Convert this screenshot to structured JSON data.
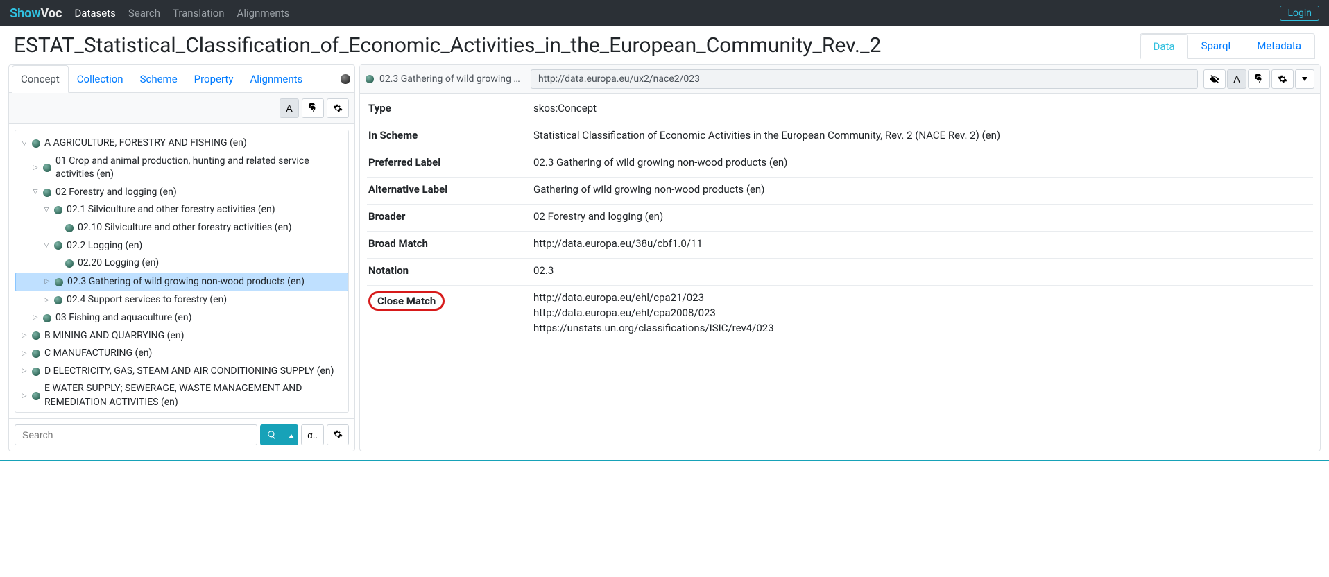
{
  "nav": {
    "brand1": "Show",
    "brand2": "Voc",
    "items": [
      "Datasets",
      "Search",
      "Translation",
      "Alignments"
    ],
    "login": "Login"
  },
  "header": {
    "title": "ESTAT_Statistical_Classification_of_Economic_Activities_in_the_European_Community_Rev._2",
    "tabs": [
      "Data",
      "Sparql",
      "Metadata"
    ]
  },
  "leftTabs": [
    "Concept",
    "Collection",
    "Scheme",
    "Property",
    "Alignments"
  ],
  "toolbar": {
    "alpha": "A"
  },
  "tree": [
    {
      "indent": 0,
      "caret": "open",
      "label": "A AGRICULTURE, FORESTRY AND FISHING (en)"
    },
    {
      "indent": 1,
      "caret": "closed",
      "label": "01 Crop and animal production, hunting and related service activities (en)"
    },
    {
      "indent": 1,
      "caret": "open",
      "label": "02 Forestry and logging (en)"
    },
    {
      "indent": 2,
      "caret": "open",
      "label": "02.1 Silviculture and other forestry activities (en)"
    },
    {
      "indent": 3,
      "caret": "none",
      "label": "02.10 Silviculture and other forestry activities (en)"
    },
    {
      "indent": 2,
      "caret": "open",
      "label": "02.2 Logging (en)"
    },
    {
      "indent": 3,
      "caret": "none",
      "label": "02.20 Logging (en)"
    },
    {
      "indent": 2,
      "caret": "closed",
      "label": "02.3 Gathering of wild growing non-wood products (en)",
      "selected": true
    },
    {
      "indent": 2,
      "caret": "closed",
      "label": "02.4 Support services to forestry (en)"
    },
    {
      "indent": 1,
      "caret": "closed",
      "label": "03 Fishing and aquaculture (en)"
    },
    {
      "indent": 0,
      "caret": "closed",
      "label": "B MINING AND QUARRYING (en)"
    },
    {
      "indent": 0,
      "caret": "closed",
      "label": "C MANUFACTURING (en)"
    },
    {
      "indent": 0,
      "caret": "closed",
      "label": "D ELECTRICITY, GAS, STEAM AND AIR CONDITIONING SUPPLY (en)"
    },
    {
      "indent": 0,
      "caret": "closed",
      "label": "E WATER SUPPLY; SEWERAGE, WASTE MANAGEMENT AND REMEDIATION ACTIVITIES (en)"
    }
  ],
  "search": {
    "placeholder": "Search",
    "alpha": "α.."
  },
  "detail": {
    "title": "02.3 Gathering of wild growing no...",
    "uri": "http://data.europa.eu/ux2/nace2/023",
    "props": [
      {
        "label": "Type",
        "values": [
          "skos:Concept"
        ]
      },
      {
        "label": "In Scheme",
        "values": [
          "Statistical Classification of Economic Activities in the European Community, Rev. 2 (NACE Rev. 2) (en)"
        ]
      },
      {
        "label": "Preferred Label",
        "values": [
          "02.3 Gathering of wild growing non-wood products  (en)"
        ]
      },
      {
        "label": "Alternative Label",
        "values": [
          "Gathering of wild growing non-wood products  (en)"
        ]
      },
      {
        "label": "Broader",
        "values": [
          "02 Forestry and logging (en)"
        ]
      },
      {
        "label": "Broad Match",
        "values": [
          "http://data.europa.eu/38u/cbf1.0/11"
        ]
      },
      {
        "label": "Notation",
        "values": [
          "02.3"
        ]
      },
      {
        "label": "Close Match",
        "highlight": true,
        "values": [
          "http://data.europa.eu/ehl/cpa21/023",
          "http://data.europa.eu/ehl/cpa2008/023",
          "https://unstats.un.org/classifications/ISIC/rev4/023"
        ]
      }
    ]
  }
}
